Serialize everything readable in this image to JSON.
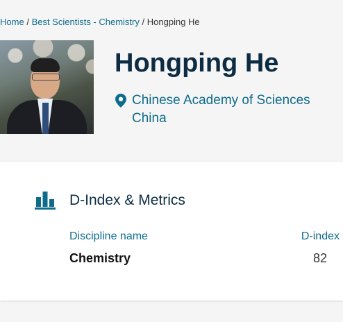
{
  "breadcrumb": {
    "home": "Home",
    "separator1": "/",
    "category": "Best Scientists - Chemistry",
    "separator2": "/",
    "current": "Hongping He"
  },
  "profile": {
    "name": "Hongping He",
    "institution": "Chinese Academy of Sciences",
    "country": "China",
    "photo_icon": "scientist-photo"
  },
  "metrics": {
    "title": "D-Index & Metrics",
    "icon": "bar-chart-icon",
    "headers": {
      "discipline": "Discipline name",
      "dindex": "D-index"
    },
    "rows": [
      {
        "discipline": "Chemistry",
        "dindex": "82"
      }
    ]
  },
  "colors": {
    "accent": "#0e6b8c",
    "heading": "#0d2c42",
    "background": "#f5f5f5",
    "card": "#ffffff"
  }
}
